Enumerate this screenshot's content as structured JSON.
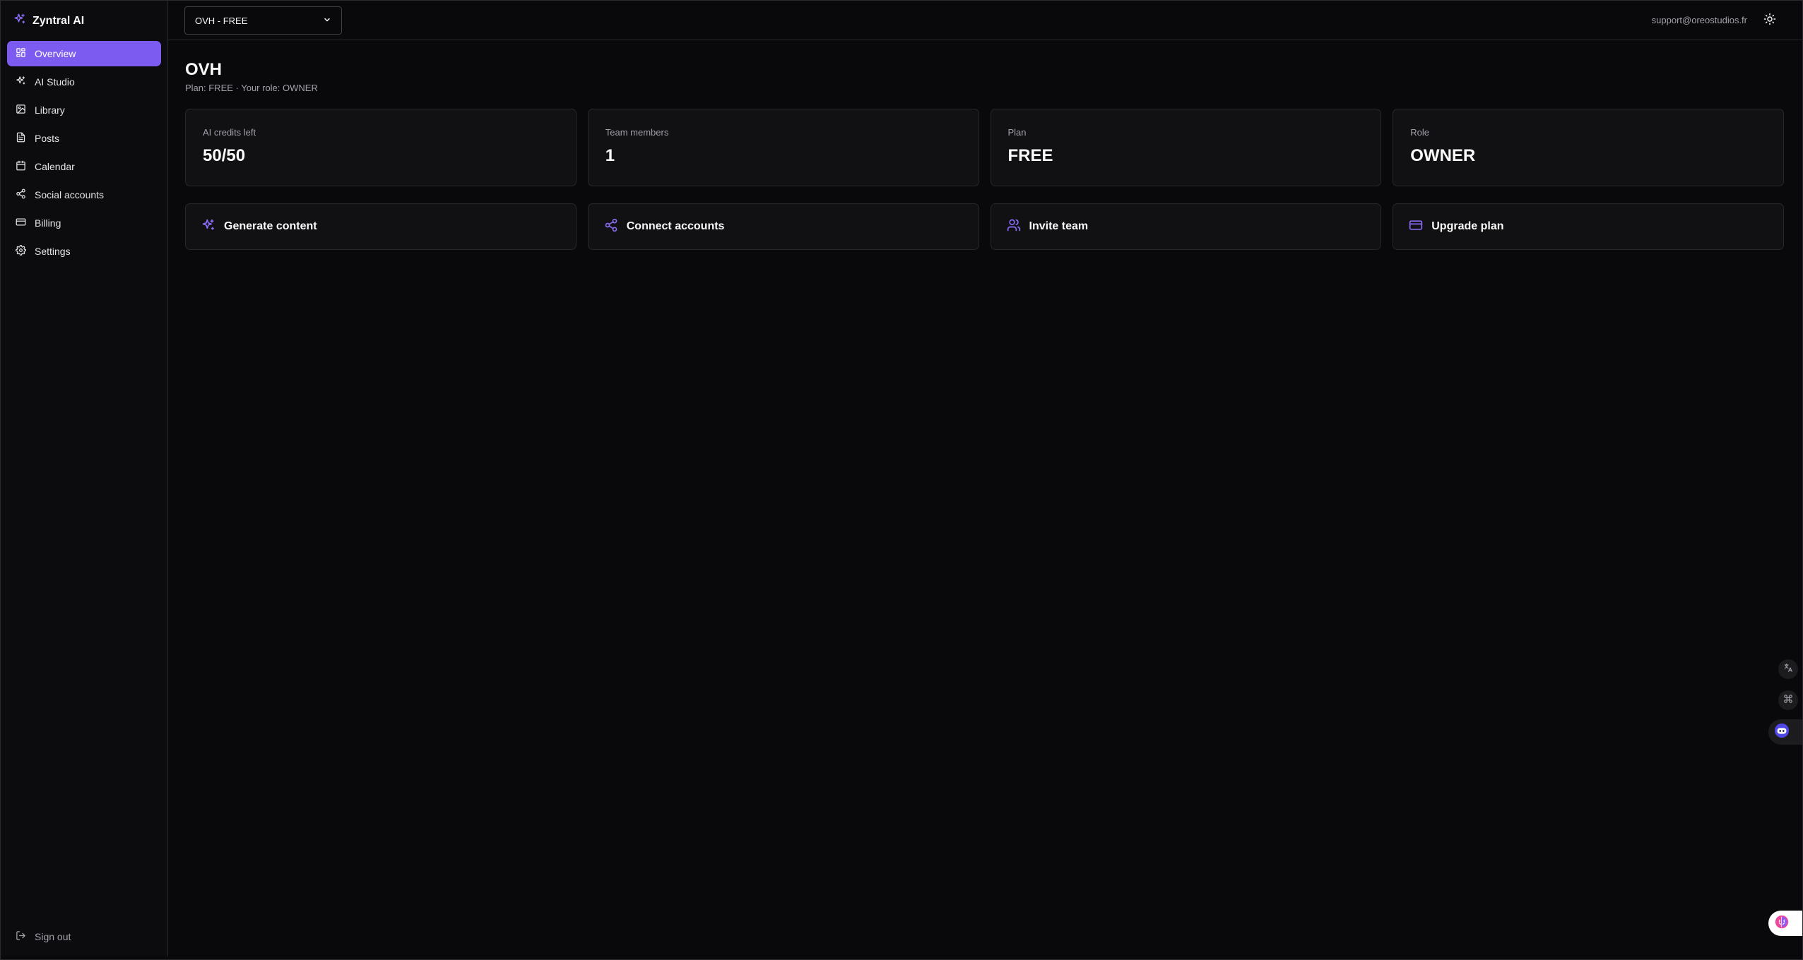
{
  "app": {
    "name": "Zyntral AI",
    "accent": "#7c5cf0"
  },
  "sidebar": {
    "items": [
      {
        "label": "Overview",
        "icon": "grid-icon",
        "active": true
      },
      {
        "label": "AI Studio",
        "icon": "sparkles-icon"
      },
      {
        "label": "Library",
        "icon": "images-icon"
      },
      {
        "label": "Posts",
        "icon": "file-text-icon"
      },
      {
        "label": "Calendar",
        "icon": "calendar-icon"
      },
      {
        "label": "Social accounts",
        "icon": "share-icon"
      },
      {
        "label": "Billing",
        "icon": "credit-card-icon"
      },
      {
        "label": "Settings",
        "icon": "gear-icon"
      }
    ],
    "signout_label": "Sign out"
  },
  "topbar": {
    "org_select_value": "OVH - FREE",
    "user_email": "support@oreostudios.fr"
  },
  "page": {
    "title": "OVH",
    "subtitle": "Plan: FREE · Your role: OWNER"
  },
  "stats": [
    {
      "label": "AI credits left",
      "value": "50/50"
    },
    {
      "label": "Team members",
      "value": "1"
    },
    {
      "label": "Plan",
      "value": "FREE"
    },
    {
      "label": "Role",
      "value": "OWNER"
    }
  ],
  "actions": [
    {
      "label": "Generate content",
      "icon": "sparkles-icon"
    },
    {
      "label": "Connect accounts",
      "icon": "share-icon"
    },
    {
      "label": "Invite team",
      "icon": "users-icon"
    },
    {
      "label": "Upgrade plan",
      "icon": "credit-card-icon"
    }
  ]
}
